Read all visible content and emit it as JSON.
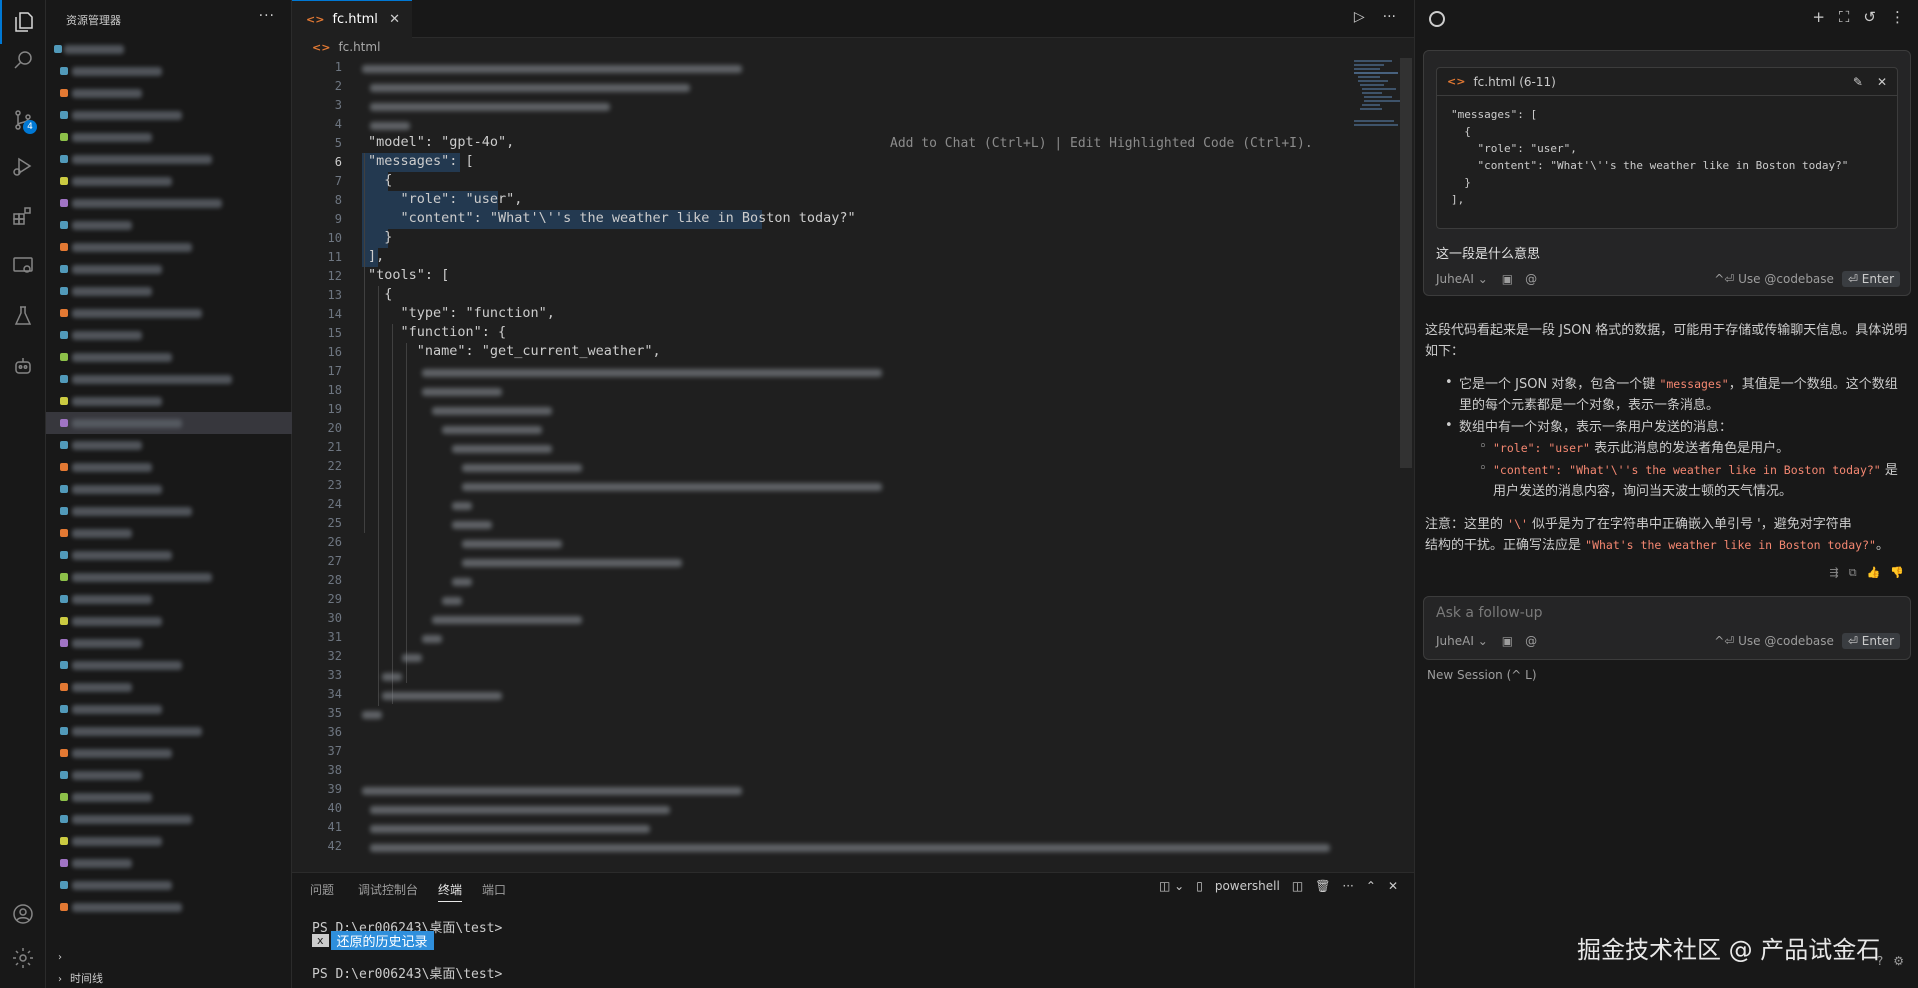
{
  "sidebar": {
    "title": "资源管理器",
    "more": "···",
    "footer_timeline": "时间线"
  },
  "activity": {
    "scm_badge": "4"
  },
  "editor": {
    "tab_name": "fc.html",
    "tab_close": "✕",
    "breadcrumb": "fc.html",
    "file_icon": "<>",
    "run": "▷",
    "more": "···",
    "inline_hint": "Add to Chat (Ctrl+L) | Edit Highlighted Code (Ctrl+I).",
    "line_numbers": [
      "1",
      "2",
      "3",
      "4",
      "5",
      "6",
      "7",
      "8",
      "9",
      "10",
      "11",
      "12",
      "13",
      "14",
      "15",
      "16",
      "17",
      "18",
      "19",
      "20",
      "21",
      "22",
      "23",
      "24",
      "25",
      "26",
      "27",
      "28",
      "29",
      "30",
      "31",
      "32",
      "33",
      "34",
      "35",
      "36",
      "37",
      "38",
      "39",
      "40",
      "41",
      "42"
    ],
    "visible_lines": {
      "l5": "\"model\": \"gpt-4o\",",
      "l6": "\"messages\": [",
      "l7": "  {",
      "l8": "    \"role\": \"user\",",
      "l9": "    \"content\": \"What'\\''s the weather like in Boston today?\"",
      "l10": "  }",
      "l11": "],",
      "l12": "\"tools\": [",
      "l13": "  {",
      "l14": "    \"type\": \"function\",",
      "l15": "    \"function\": {",
      "l16": "      \"name\": \"get_current_weather\","
    }
  },
  "panel": {
    "tabs": [
      "问题",
      "调试控制台",
      "终端",
      "端口"
    ],
    "active_tab": "终端",
    "shell": "powershell",
    "prompt1": "PS D:\\er006243\\桌面\\test>",
    "hl_x": "x",
    "hl_text": "还原的历史记录",
    "prompt2": "PS D:\\er006243\\桌面\\test>"
  },
  "chat": {
    "snippet_title": "fc.html (6-11)",
    "snippet_code": "\"messages\": [\n  {\n    \"role\": \"user\",\n    \"content\": \"What'\\''s the weather like in Boston today?\"\n  }\n],",
    "question": "这一段是什么意思",
    "model": "JuheAI",
    "use_codebase": "^⏎ Use @codebase",
    "enter": "⏎ Enter",
    "answer_intro": "这段代码看起来是一段 JSON 格式的数据，可能用于存储或传输聊天信息。具体说明如下：",
    "b1_pre": "它是一个 JSON 对象，包含一个键 ",
    "b1_code": "\"messages\"",
    "b1_post": "，其值是一个数组。这个数组里的每个元素都是一个对象，表示一条消息。",
    "b2": "数组中有一个对象，表示一条用户发送的消息：",
    "s1_code": "\"role\": \"user\"",
    "s1_text": " 表示此消息的发送者角色是用户。",
    "s2_code": "\"content\": \"What'\\''s the weather like in Boston today?\"",
    "s2_text": " 是",
    "s2_text2": "用户发送的消息内容，询问当天波士顿的天气情况。",
    "note_pre": "注意：这里的 ",
    "note_code": "'\\'",
    "note_mid": " 似乎是为了在字符串中正确嵌入单引号 '，避免对字符串",
    "note_line2_pre": "结构的干扰。正确写法应是 ",
    "note_code2": "\"What's the weather like in Boston today?\"",
    "note_end": "。",
    "followup_placeholder": "Ask a follow-up",
    "new_session": "New Session (^ L)",
    "watermark": "掘金技术社区 @ 产品试金石"
  },
  "colors": {
    "accent": "#0078d4",
    "selection": "#264f78",
    "inline_code": "#f48771",
    "terminal_highlight": "#2f8fdc"
  }
}
